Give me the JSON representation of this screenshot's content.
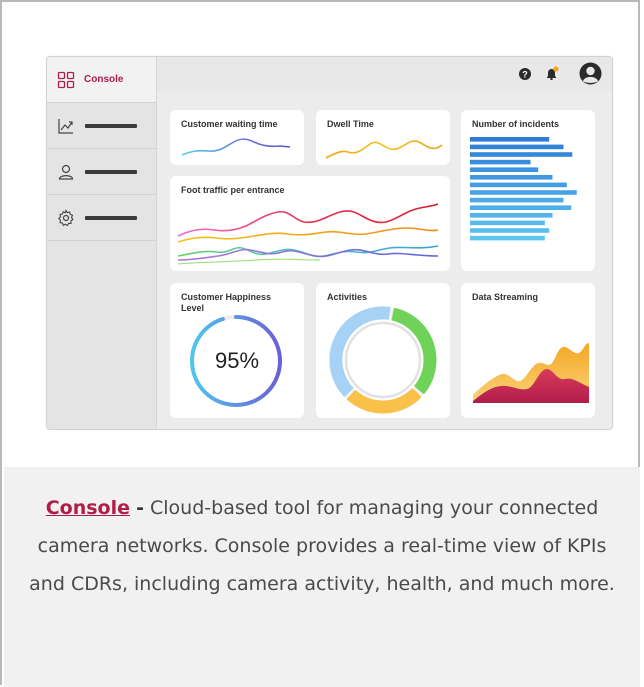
{
  "sidebar": {
    "items": [
      {
        "label": "Console",
        "icon": "grid-icon",
        "active": true
      },
      {
        "icon": "trend-icon"
      },
      {
        "icon": "user-icon"
      },
      {
        "icon": "gear-icon"
      }
    ]
  },
  "topbar": {
    "icons": [
      "help-icon",
      "notification-bell-icon",
      "avatar-icon"
    ],
    "notification_color": "#f5a623"
  },
  "cards": {
    "waiting": {
      "title": "Customer waiting time"
    },
    "dwell": {
      "title": "Dwell Time"
    },
    "incidents": {
      "title": "Number of incidents",
      "values": [
        0.72,
        0.85,
        0.93,
        0.55,
        0.62,
        0.75,
        0.88,
        0.97,
        0.85,
        0.92,
        0.75,
        0.68,
        0.72,
        0.68
      ],
      "color": "#2e7cd6"
    },
    "foot_traffic": {
      "title": "Foot traffic per entrance"
    },
    "happiness": {
      "title": "Customer Happiness Level",
      "value": "95%",
      "level": 0.95
    },
    "activities": {
      "title": "Activities"
    },
    "streaming": {
      "title": "Data Streaming"
    }
  },
  "caption": {
    "link": "Console",
    "separator": "-",
    "text": "Cloud-based tool for managing your connected camera networks. Console provides a real-time view of KPIs and CDRs, including camera activity, health, and much more."
  },
  "colors": {
    "brand": "#b01d4a"
  }
}
